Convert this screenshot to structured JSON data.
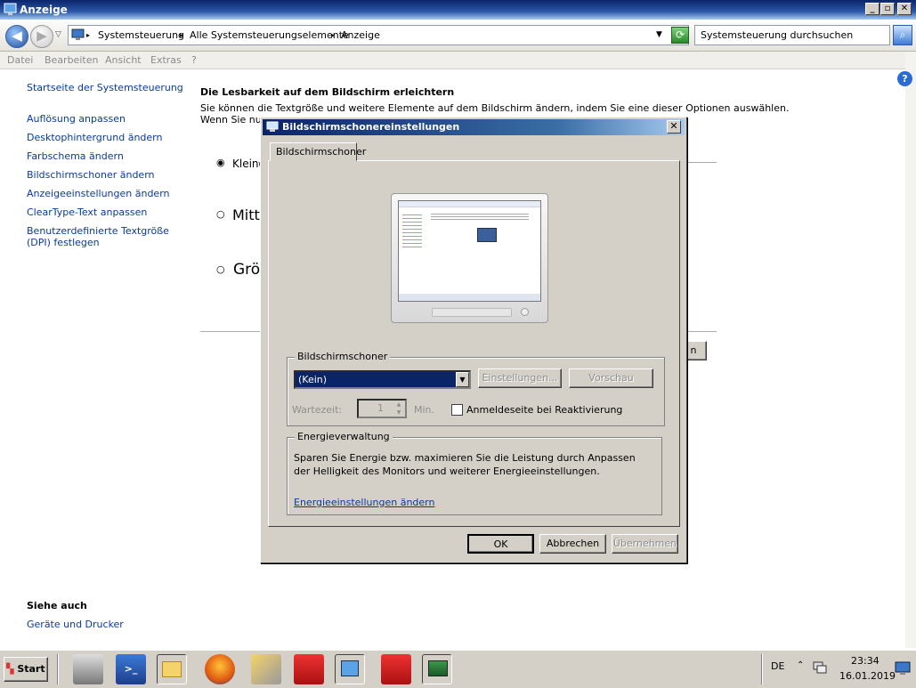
{
  "window": {
    "title": "Anzeige"
  },
  "address": {
    "crumbs": [
      "Systemsteuerung",
      "Alle Systemsteuerungselemente",
      "Anzeige"
    ],
    "search_placeholder": "Systemsteuerung durchsuchen"
  },
  "menu": [
    "Datei",
    "Bearbeiten",
    "Ansicht",
    "Extras",
    "?"
  ],
  "sidebar": {
    "home": "Startseite der Systemsteuerung",
    "items": [
      "Auflösung anpassen",
      "Desktophintergrund ändern",
      "Farbschema ändern",
      "Bildschirmschoner ändern",
      "Anzeigeeinstellungen ändern",
      "ClearType-Text anpassen",
      "Benutzerdefinierte Textgröße",
      "(DPI) festlegen"
    ],
    "see_also_title": "Siehe auch",
    "see_also_items": [
      "Geräte und Drucker"
    ]
  },
  "main": {
    "heading": "Die Lesbarkeit auf dem Bildschirm erleichtern",
    "desc1": "Sie können die Textgröße und weitere Elemente auf dem Bildschirm ändern, indem Sie eine dieser Optionen auswählen.",
    "desc2": "Wenn Sie nur e",
    "options": [
      "Kleine",
      "Mitte",
      "Grö"
    ],
    "apply_fragment": "n"
  },
  "dialog": {
    "title": "Bildschirmschonereinstellungen",
    "tab": "Bildschirmschoner",
    "screensaver_group": "Bildschirmschoner",
    "screensaver_selected": "(Kein)",
    "settings_button": "Einstellungen...",
    "preview_button": "Vorschau",
    "wait_label": "Wartezeit:",
    "wait_value": "1",
    "wait_unit": "Min.",
    "resume_label": "Anmeldeseite bei Reaktivierung",
    "power_group": "Energieverwaltung",
    "power_text": "Sparen Sie Energie bzw. maximieren Sie die Leistung durch Anpassen der Helligkeit des Monitors und weiterer Energieeinstellungen.",
    "power_link": "Energieeinstellungen ändern",
    "ok": "OK",
    "cancel": "Abbrechen",
    "apply": "Übernehmen"
  },
  "taskbar": {
    "start": "Start",
    "lang": "DE",
    "time": "23:34",
    "date": "16.01.2019"
  }
}
